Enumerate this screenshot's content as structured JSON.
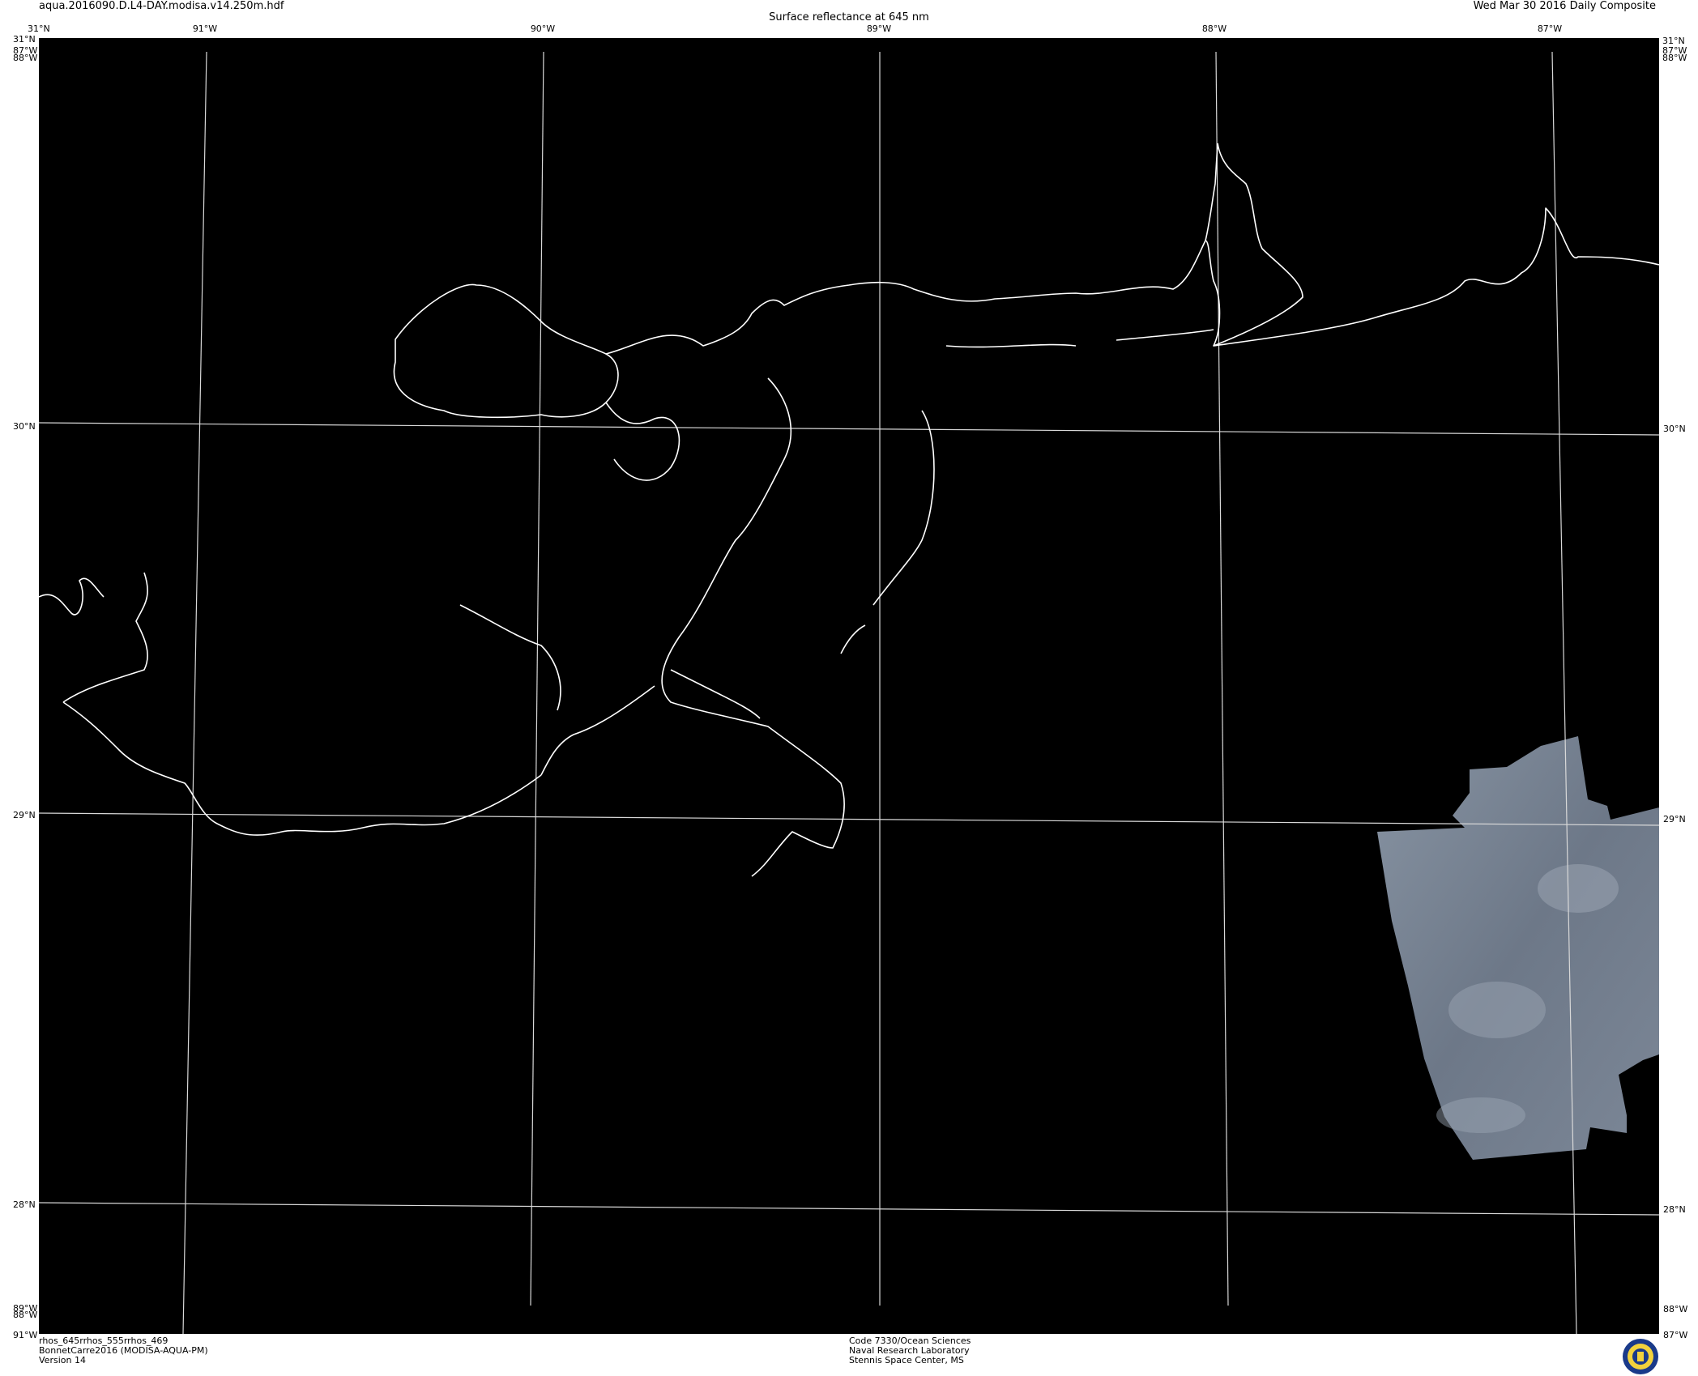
{
  "header": {
    "filename": "aqua.2016090.D.L4-DAY.modisa.v14.250m.hdf",
    "product_title": "Surface reflectance at 645 nm",
    "date_label": "Wed Mar 30 2016 Daily Composite"
  },
  "top_lon_labels": [
    "91°W",
    "90°W",
    "89°W",
    "88°W",
    "87°W"
  ],
  "side_lat_labels": [
    "30°N",
    "29°N",
    "28°N"
  ],
  "corner_labels": {
    "top_left_lat": "31°N",
    "top_left_lon": "87°W",
    "top_left_lon2": "88°W",
    "top_right_lat": "31°N",
    "top_right_lon": "87°W",
    "top_right_lon2": "88°W",
    "bottom_left_lon": "89°W",
    "bottom_left_lon2": "88°W",
    "bottom_left_lon3": "91°W",
    "bottom_right_lon": "88°W",
    "bottom_right_lon2": "87°W"
  },
  "footer_left": [
    "rhos_645rrhos_555rrhos_469",
    "BonnetCarre2016 (MODISA-AQUA-PM)",
    "Version 14"
  ],
  "footer_center": [
    "Code 7330/Ocean Sciences",
    "Naval Research Laboratory",
    "Stennis Space Center, MS"
  ],
  "colors": {
    "background": "#000000",
    "coastline": "#ffffff",
    "grid": "#d9d9d9",
    "imagery_swath": "#6f7a88",
    "logo_ring": "#1a3a8a",
    "logo_fill": "#f2d23c"
  },
  "icons": {
    "logo": "nrl-seal-icon"
  }
}
